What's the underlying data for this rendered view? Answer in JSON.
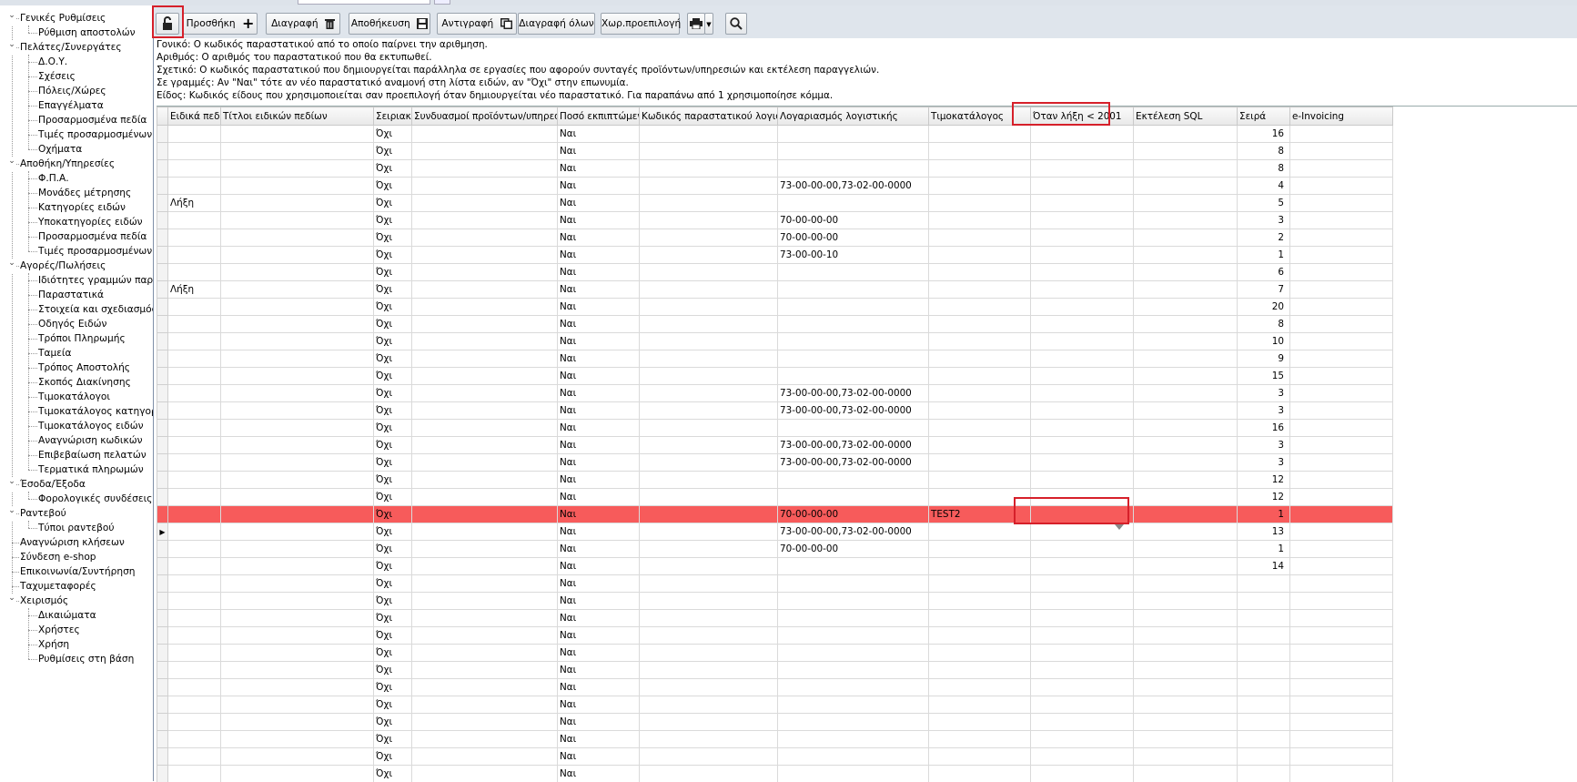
{
  "tree": {
    "items": [
      {
        "label": "Γενικές Ρυθμίσεις",
        "level": 0,
        "expanded": true
      },
      {
        "label": "Ρύθμιση αποστολών",
        "level": 1
      },
      {
        "label": "Πελάτες/Συνεργάτες",
        "level": 0,
        "expanded": true
      },
      {
        "label": "Δ.Ο.Υ.",
        "level": 1
      },
      {
        "label": "Σχέσεις",
        "level": 1
      },
      {
        "label": "Πόλεις/Χώρες",
        "level": 1
      },
      {
        "label": "Επαγγέλματα",
        "level": 1
      },
      {
        "label": "Προσαρμοσμένα πεδία",
        "level": 1
      },
      {
        "label": "Τιμές προσαρμοσμένων π",
        "level": 1
      },
      {
        "label": "Οχήματα",
        "level": 1
      },
      {
        "label": "Αποθήκη/Υπηρεσίες",
        "level": 0,
        "expanded": true
      },
      {
        "label": "Φ.Π.Α.",
        "level": 1
      },
      {
        "label": "Μονάδες μέτρησης",
        "level": 1
      },
      {
        "label": "Κατηγορίες ειδών",
        "level": 1
      },
      {
        "label": "Υποκατηγορίες ειδών",
        "level": 1
      },
      {
        "label": "Προσαρμοσμένα πεδία",
        "level": 1
      },
      {
        "label": "Τιμές προσαρμοσμένων π",
        "level": 1
      },
      {
        "label": "Αγορές/Πωλήσεις",
        "level": 0,
        "expanded": true
      },
      {
        "label": "Ιδιότητες γραμμών παραστ",
        "level": 1
      },
      {
        "label": "Παραστατικά",
        "level": 1
      },
      {
        "label": "Στοιχεία και σχεδιασμός πα",
        "level": 1
      },
      {
        "label": "Οδηγός Ειδών",
        "level": 1
      },
      {
        "label": "Τρόποι Πληρωμής",
        "level": 1
      },
      {
        "label": "Ταμεία",
        "level": 1
      },
      {
        "label": "Τρόπος Αποστολής",
        "level": 1
      },
      {
        "label": "Σκοπός Διακίνησης",
        "level": 1
      },
      {
        "label": "Τιμοκατάλογοι",
        "level": 1
      },
      {
        "label": "Τιμοκατάλογος κατηγοριώ",
        "level": 1
      },
      {
        "label": "Τιμοκατάλογος ειδών",
        "level": 1
      },
      {
        "label": "Αναγνώριση κωδικών",
        "level": 1
      },
      {
        "label": "Επιβεβαίωση πελατών",
        "level": 1
      },
      {
        "label": "Τερματικά πληρωμών",
        "level": 1
      },
      {
        "label": "Έσοδα/Έξοδα",
        "level": 0,
        "expanded": true
      },
      {
        "label": "Φορολογικές συνδέσεις",
        "level": 1
      },
      {
        "label": "Ραντεβού",
        "level": 0,
        "expanded": true
      },
      {
        "label": "Τύποι ραντεβού",
        "level": 1
      },
      {
        "label": "Αναγνώριση κλήσεων",
        "level": 0
      },
      {
        "label": "Σύνδεση e-shop",
        "level": 0
      },
      {
        "label": "Επικοινωνία/Συντήρηση",
        "level": 0
      },
      {
        "label": "Ταχυμεταφορές",
        "level": 0
      },
      {
        "label": "Χειρισμός",
        "level": 0,
        "expanded": true
      },
      {
        "label": "Δικαιώματα",
        "level": 1
      },
      {
        "label": "Χρήστες",
        "level": 1
      },
      {
        "label": "Χρήση",
        "level": 1
      },
      {
        "label": "Ρυθμίσεις στη βάση",
        "level": 1
      }
    ]
  },
  "toolbar": {
    "lock_icon": "unlock-icon",
    "add": "Προσθήκη",
    "delete": "Διαγραφή",
    "save": "Αποθήκευση",
    "copy": "Αντιγραφή",
    "delete_all": "Διαγραφή όλων",
    "no_default": "Χωρ.προεπιλογή",
    "print_icon": "print-icon",
    "search_icon": "search-icon"
  },
  "help": [
    "Γονικό: Ο κωδικός παραστατικού από το οποίο παίρνει την αριθμηση.",
    "Αριθμός: Ο αριθμός του παραστατικού που θα εκτυπωθεί.",
    "Σχετικό: Ο κωδικός παραστατικού που δημιουργείται παράλληλα σε εργασίες που αφορούν συνταγές προϊόντων/υπηρεσιών και εκτέλεση παραγγελιών.",
    "Σε γραμμές: Αν \"Ναι\" τότε αν νέο παραστατικό αναμονή στη λίστα ειδών, αν \"Όχι\" στην επωνυμία.",
    "Είδος: Κωδικός είδους που χρησιμοποιείται σαν προεπιλογή όταν δημιουργείται νέο παραστατικό. Για παραπάνω από 1 χρησιμοποίησε κόμμα."
  ],
  "grid": {
    "columns": [
      "Ειδικά πεδία",
      "Τίτλοι ειδικών πεδίων",
      "Σειριακοί",
      "Συνδυασμοί προϊόντων/υπηρεσιών",
      "Ποσό εκπιπτώμενο",
      "Κωδικός παραστατικού λογιστικής",
      "Λογαριασμός λογιστικής",
      "Τιμοκατάλογος",
      "Όταν λήξη < 2001",
      "Εκτέλεση SQL",
      "Σειρά",
      "e-Invoicing"
    ],
    "rows": [
      [
        "",
        "",
        "Όχι",
        "",
        "Ναι",
        "",
        "",
        "",
        "",
        "",
        "16",
        ""
      ],
      [
        "",
        "",
        "Όχι",
        "",
        "Ναι",
        "",
        "",
        "",
        "",
        "",
        "8",
        ""
      ],
      [
        "",
        "",
        "Όχι",
        "",
        "Ναι",
        "",
        "",
        "",
        "",
        "",
        "8",
        ""
      ],
      [
        "",
        "",
        "Όχι",
        "",
        "Ναι",
        "",
        "73-00-00-00,73-02-00-0000",
        "",
        "",
        "",
        "4",
        ""
      ],
      [
        "Λήξη",
        "",
        "Όχι",
        "",
        "Ναι",
        "",
        "",
        "",
        "",
        "",
        "5",
        ""
      ],
      [
        "",
        "",
        "Όχι",
        "",
        "Ναι",
        "",
        "70-00-00-00",
        "",
        "",
        "",
        "3",
        ""
      ],
      [
        "",
        "",
        "Όχι",
        "",
        "Ναι",
        "",
        "70-00-00-00",
        "",
        "",
        "",
        "2",
        ""
      ],
      [
        "",
        "",
        "Όχι",
        "",
        "Ναι",
        "",
        "73-00-00-10",
        "",
        "",
        "",
        "1",
        ""
      ],
      [
        "",
        "",
        "Όχι",
        "",
        "Ναι",
        "",
        "",
        "",
        "",
        "",
        "6",
        ""
      ],
      [
        "Λήξη",
        "",
        "Όχι",
        "",
        "Ναι",
        "",
        "",
        "",
        "",
        "",
        "7",
        ""
      ],
      [
        "",
        "",
        "Όχι",
        "",
        "Ναι",
        "",
        "",
        "",
        "",
        "",
        "20",
        ""
      ],
      [
        "",
        "",
        "Όχι",
        "",
        "Ναι",
        "",
        "",
        "",
        "",
        "",
        "8",
        ""
      ],
      [
        "",
        "",
        "Όχι",
        "",
        "Ναι",
        "",
        "",
        "",
        "",
        "",
        "10",
        ""
      ],
      [
        "",
        "",
        "Όχι",
        "",
        "Ναι",
        "",
        "",
        "",
        "",
        "",
        "9",
        ""
      ],
      [
        "",
        "",
        "Όχι",
        "",
        "Ναι",
        "",
        "",
        "",
        "",
        "",
        "15",
        ""
      ],
      [
        "",
        "",
        "Όχι",
        "",
        "Ναι",
        "",
        "73-00-00-00,73-02-00-0000",
        "",
        "",
        "",
        "3",
        ""
      ],
      [
        "",
        "",
        "Όχι",
        "",
        "Ναι",
        "",
        "73-00-00-00,73-02-00-0000",
        "",
        "",
        "",
        "3",
        ""
      ],
      [
        "",
        "",
        "Όχι",
        "",
        "Ναι",
        "",
        "",
        "",
        "",
        "",
        "16",
        ""
      ],
      [
        "",
        "",
        "Όχι",
        "",
        "Ναι",
        "",
        "73-00-00-00,73-02-00-0000",
        "",
        "",
        "",
        "3",
        ""
      ],
      [
        "",
        "",
        "Όχι",
        "",
        "Ναι",
        "",
        "73-00-00-00,73-02-00-0000",
        "",
        "",
        "",
        "3",
        ""
      ],
      [
        "",
        "",
        "Όχι",
        "",
        "Ναι",
        "",
        "",
        "",
        "",
        "",
        "12",
        ""
      ],
      [
        "",
        "",
        "Όχι",
        "",
        "Ναι",
        "",
        "",
        "",
        "",
        "",
        "12",
        ""
      ],
      [
        "",
        "",
        "Όχι",
        "",
        "Ναι",
        "",
        "70-00-00-00",
        "TEST2",
        "",
        "",
        "1",
        ""
      ],
      [
        "",
        "",
        "Όχι",
        "",
        "Ναι",
        "",
        "73-00-00-00,73-02-00-0000",
        "",
        "",
        "",
        "13",
        ""
      ],
      [
        "",
        "",
        "Όχι",
        "",
        "Ναι",
        "",
        "70-00-00-00",
        "",
        "",
        "",
        "1",
        ""
      ],
      [
        "",
        "",
        "Όχι",
        "",
        "Ναι",
        "",
        "",
        "",
        "",
        "",
        "14",
        ""
      ],
      [
        "",
        "",
        "Όχι",
        "",
        "Ναι",
        "",
        "",
        "",
        "",
        "",
        "",
        ""
      ],
      [
        "",
        "",
        "Όχι",
        "",
        "Ναι",
        "",
        "",
        "",
        "",
        "",
        "",
        ""
      ],
      [
        "",
        "",
        "Όχι",
        "",
        "Ναι",
        "",
        "",
        "",
        "",
        "",
        "",
        ""
      ],
      [
        "",
        "",
        "Όχι",
        "",
        "Ναι",
        "",
        "",
        "",
        "",
        "",
        "",
        ""
      ],
      [
        "",
        "",
        "Όχι",
        "",
        "Ναι",
        "",
        "",
        "",
        "",
        "",
        "",
        ""
      ],
      [
        "",
        "",
        "Όχι",
        "",
        "Ναι",
        "",
        "",
        "",
        "",
        "",
        "",
        ""
      ],
      [
        "",
        "",
        "Όχι",
        "",
        "Ναι",
        "",
        "",
        "",
        "",
        "",
        "",
        ""
      ],
      [
        "",
        "",
        "Όχι",
        "",
        "Ναι",
        "",
        "",
        "",
        "",
        "",
        "",
        ""
      ],
      [
        "",
        "",
        "Όχι",
        "",
        "Ναι",
        "",
        "",
        "",
        "",
        "",
        "",
        ""
      ],
      [
        "",
        "",
        "Όχι",
        "",
        "Ναι",
        "",
        "",
        "",
        "",
        "",
        "",
        ""
      ],
      [
        "",
        "",
        "Όχι",
        "",
        "Ναι",
        "",
        "",
        "",
        "",
        "",
        "",
        ""
      ],
      [
        "",
        "",
        "Όχι",
        "",
        "Ναι",
        "",
        "",
        "",
        "",
        "",
        "",
        ""
      ],
      [
        "",
        "",
        "Όχι",
        "",
        "Ναι",
        "",
        "",
        "",
        "",
        "",
        "",
        ""
      ]
    ],
    "selected_row": 22,
    "current_row": 23,
    "highlight_color": "#f75b5b"
  }
}
